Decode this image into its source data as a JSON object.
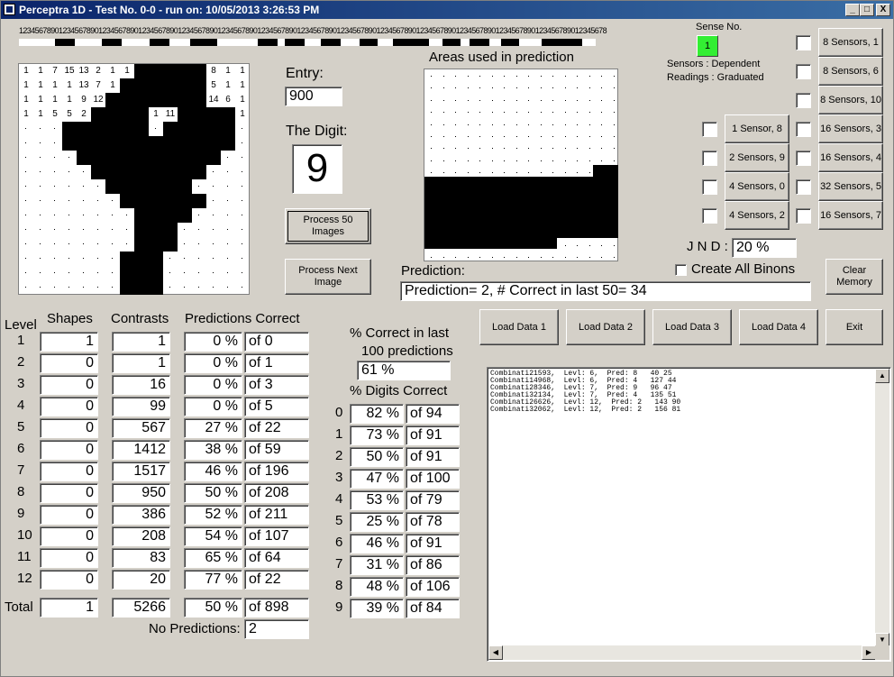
{
  "window": {
    "title": "Perceptra 1D - Test No. 0-0 - run on: 10/05/2013 3:26:53 PM",
    "min": "_",
    "max": "□",
    "close": "X"
  },
  "ruler": {
    "digits": "1234567890123456789012345678901234567890123456789012345678901234567890123456789012345678901234567890123456789012345678901234567890123456789012345678"
  },
  "grid": {
    "numbers": [
      {
        "r": 0,
        "c": 0,
        "t": "1"
      },
      {
        "r": 0,
        "c": 1,
        "t": "1"
      },
      {
        "r": 0,
        "c": 2,
        "t": "7"
      },
      {
        "r": 0,
        "c": 3,
        "t": "15"
      },
      {
        "r": 0,
        "c": 4,
        "t": "13"
      },
      {
        "r": 0,
        "c": 5,
        "t": "2"
      },
      {
        "r": 0,
        "c": 6,
        "t": "1"
      },
      {
        "r": 0,
        "c": 7,
        "t": "1"
      },
      {
        "r": 0,
        "c": 13,
        "t": "8"
      },
      {
        "r": 0,
        "c": 14,
        "t": "1"
      },
      {
        "r": 0,
        "c": 15,
        "t": "1"
      },
      {
        "r": 1,
        "c": 0,
        "t": "1"
      },
      {
        "r": 1,
        "c": 1,
        "t": "1"
      },
      {
        "r": 1,
        "c": 2,
        "t": "1"
      },
      {
        "r": 1,
        "c": 3,
        "t": "1"
      },
      {
        "r": 1,
        "c": 4,
        "t": "13"
      },
      {
        "r": 1,
        "c": 5,
        "t": "7"
      },
      {
        "r": 1,
        "c": 6,
        "t": "1"
      },
      {
        "r": 1,
        "c": 13,
        "t": "5"
      },
      {
        "r": 1,
        "c": 14,
        "t": "1"
      },
      {
        "r": 1,
        "c": 15,
        "t": "1"
      },
      {
        "r": 2,
        "c": 0,
        "t": "1"
      },
      {
        "r": 2,
        "c": 1,
        "t": "1"
      },
      {
        "r": 2,
        "c": 2,
        "t": "1"
      },
      {
        "r": 2,
        "c": 3,
        "t": "1"
      },
      {
        "r": 2,
        "c": 4,
        "t": "9"
      },
      {
        "r": 2,
        "c": 5,
        "t": "12"
      },
      {
        "r": 2,
        "c": 13,
        "t": "14"
      },
      {
        "r": 2,
        "c": 14,
        "t": "6"
      },
      {
        "r": 2,
        "c": 15,
        "t": "1"
      },
      {
        "r": 3,
        "c": 0,
        "t": "1"
      },
      {
        "r": 3,
        "c": 1,
        "t": "1"
      },
      {
        "r": 3,
        "c": 2,
        "t": "5"
      },
      {
        "r": 3,
        "c": 3,
        "t": "5"
      },
      {
        "r": 3,
        "c": 4,
        "t": "2"
      },
      {
        "r": 3,
        "c": 9,
        "t": "1"
      },
      {
        "r": 3,
        "c": 10,
        "t": "11"
      },
      {
        "r": 3,
        "c": 15,
        "t": "1"
      }
    ]
  },
  "labels": {
    "entry": "Entry:",
    "the_digit": "The Digit:",
    "areas": "Areas used in prediction",
    "sense_no": "Sense No.",
    "sensors": "Sensors  :  Dependent",
    "readings": "Readings :  Graduated",
    "jnd": "J N D :",
    "create_all": "Create All Binons",
    "prediction": "Prediction:",
    "level": "Level",
    "shapes": "Shapes",
    "contrasts": "Contrasts",
    "predictions_correct": "Predictions Correct",
    "pct_last": "% Correct in last",
    "hundred": "100 predictions",
    "digits_correct": "% Digits Correct",
    "total": "Total",
    "no_predictions": "No Predictions:"
  },
  "values": {
    "entry": "900",
    "digit": "9",
    "sense_no": "1",
    "jnd": "20 %",
    "prediction": "Prediction= 2, # Correct in last 50= 34",
    "pct_last": "61 %",
    "total_shapes": "1",
    "total_contrasts": "5266",
    "total_pct": "50 %",
    "total_of": "of 898",
    "no_predictions": "2"
  },
  "buttons": {
    "process50": "Process 50 Images",
    "process_next": "Process Next Image",
    "clear_memory": "Clear Memory",
    "load1": "Load Data 1",
    "load2": "Load Data 2",
    "load3": "Load Data 3",
    "load4": "Load Data 4",
    "exit": "Exit"
  },
  "sensor_buttons": {
    "right": [
      "8 Sensors, 1",
      "8 Sensors, 6",
      "8 Sensors, 10",
      "16 Sensors, 3",
      "16 Sensors, 4",
      "32 Sensors, 5",
      "16 Sensors, 7"
    ],
    "left": [
      "1 Sensor, 8",
      "2 Sensors, 9",
      "4 Sensors, 0",
      "4 Sensors, 2"
    ]
  },
  "levels": [
    {
      "n": "1",
      "shapes": "1",
      "contrasts": "1",
      "pct": "0 %",
      "of": "of 0"
    },
    {
      "n": "2",
      "shapes": "0",
      "contrasts": "1",
      "pct": "0 %",
      "of": "of 1"
    },
    {
      "n": "3",
      "shapes": "0",
      "contrasts": "16",
      "pct": "0 %",
      "of": "of 3"
    },
    {
      "n": "4",
      "shapes": "0",
      "contrasts": "99",
      "pct": "0 %",
      "of": "of 5"
    },
    {
      "n": "5",
      "shapes": "0",
      "contrasts": "567",
      "pct": "27 %",
      "of": "of 22"
    },
    {
      "n": "6",
      "shapes": "0",
      "contrasts": "1412",
      "pct": "38 %",
      "of": "of 59"
    },
    {
      "n": "7",
      "shapes": "0",
      "contrasts": "1517",
      "pct": "46 %",
      "of": "of 196"
    },
    {
      "n": "8",
      "shapes": "0",
      "contrasts": "950",
      "pct": "50 %",
      "of": "of 208"
    },
    {
      "n": "9",
      "shapes": "0",
      "contrasts": "386",
      "pct": "52 %",
      "of": "of 211"
    },
    {
      "n": "10",
      "shapes": "0",
      "contrasts": "208",
      "pct": "54 %",
      "of": "of 107"
    },
    {
      "n": "11",
      "shapes": "0",
      "contrasts": "83",
      "pct": "65 %",
      "of": "of 64"
    },
    {
      "n": "12",
      "shapes": "0",
      "contrasts": "20",
      "pct": "77 %",
      "of": "of 22"
    }
  ],
  "digits": [
    {
      "d": "0",
      "pct": "82 %",
      "of": "of 94"
    },
    {
      "d": "1",
      "pct": "73 %",
      "of": "of 91"
    },
    {
      "d": "2",
      "pct": "50 %",
      "of": "of 91"
    },
    {
      "d": "3",
      "pct": "47 %",
      "of": "of 100"
    },
    {
      "d": "4",
      "pct": "53 %",
      "of": "of 79"
    },
    {
      "d": "5",
      "pct": "25 %",
      "of": "of 78"
    },
    {
      "d": "6",
      "pct": "46 %",
      "of": "of 91"
    },
    {
      "d": "7",
      "pct": "31 %",
      "of": "of 86"
    },
    {
      "d": "8",
      "pct": "48 %",
      "of": "of 106"
    },
    {
      "d": "9",
      "pct": "39 %",
      "of": "of 84"
    }
  ],
  "output_lines": [
    "Combinati21593,  Levl: 6,  Pred: 8   40 25",
    "Combinati14968,  Levl: 6,  Pred: 4   127 44",
    "Combinati28346,  Levl: 7,  Pred: 9   96 47",
    "Combinati32134,  Levl: 7,  Pred: 4   135 51",
    "Combinati26626,  Levl: 12,  Pred: 2   143 90",
    "Combinati32062,  Levl: 12,  Pred: 2   156 81"
  ],
  "colors": {
    "sense_green": "#33ee33",
    "title_start": "#0a246a",
    "title_end": "#3a6ea5"
  }
}
